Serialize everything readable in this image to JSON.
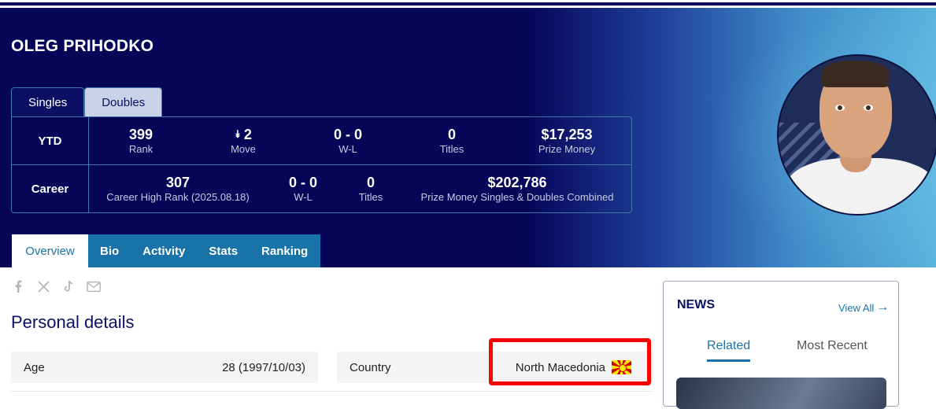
{
  "player": {
    "name": "OLEG PRIHODKO"
  },
  "record_tabs": [
    {
      "label": "Singles",
      "active": true
    },
    {
      "label": "Doubles",
      "active": false
    }
  ],
  "ytd": {
    "label": "YTD",
    "rank": {
      "value": "399",
      "label": "Rank"
    },
    "move": {
      "value": "2",
      "label": "Move",
      "direction": "down"
    },
    "wl": {
      "value": "0 - 0",
      "label": "W-L"
    },
    "titles": {
      "value": "0",
      "label": "Titles"
    },
    "prize": {
      "value": "$17,253",
      "label": "Prize Money"
    }
  },
  "career": {
    "label": "Career",
    "high_rank": {
      "value": "307",
      "label": "Career High Rank (2025.08.18)"
    },
    "wl": {
      "value": "0 - 0",
      "label": "W-L"
    },
    "titles": {
      "value": "0",
      "label": "Titles"
    },
    "prize": {
      "value": "$202,786",
      "label": "Prize Money Singles & Doubles Combined"
    }
  },
  "nav_tabs": [
    "Overview",
    "Bio",
    "Activity",
    "Stats",
    "Ranking"
  ],
  "share_icons": [
    "facebook-icon",
    "x-icon",
    "tiktok-icon",
    "email-icon"
  ],
  "personal": {
    "title": "Personal details",
    "age_label": "Age",
    "age_value": "28 (1997/10/03)",
    "country_label": "Country",
    "country_value": "North Macedonia"
  },
  "news": {
    "title": "NEWS",
    "view_all": "View All",
    "tabs": [
      "Related",
      "Most Recent"
    ],
    "active_tab": "Related"
  },
  "colors": {
    "navy": "#060558",
    "accent_blue": "#1a73a8",
    "highlight_red": "#ff0000"
  }
}
